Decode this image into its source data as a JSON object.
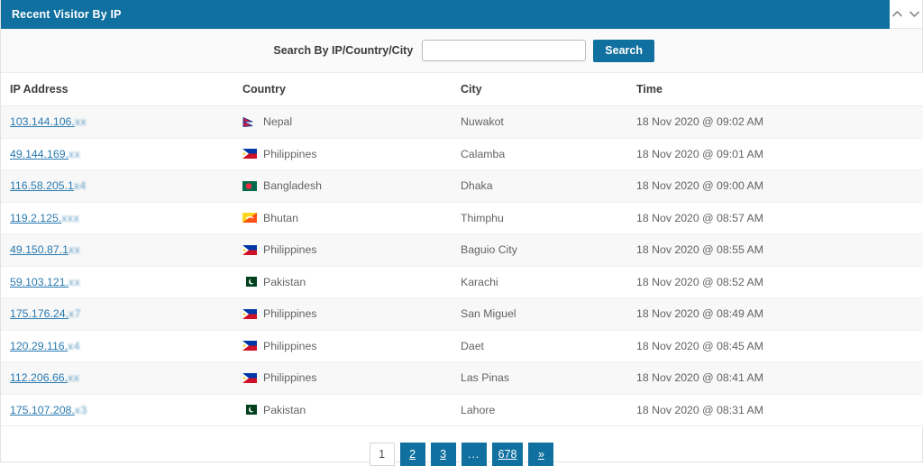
{
  "widget": {
    "title": "Recent Visitor By IP",
    "collapse_icon": "chevron-up-icon",
    "expand_icon": "chevron-down-icon"
  },
  "search": {
    "label": "Search By IP/Country/City",
    "value": "",
    "placeholder": "",
    "button_label": "Search"
  },
  "table": {
    "columns": [
      "IP Address",
      "Country",
      "City",
      "Time"
    ],
    "rows": [
      {
        "ip_visible": "103.144.106.",
        "ip_masked": "xx",
        "country": "Nepal",
        "flag": "flag-nepal",
        "city": "Nuwakot",
        "time": "18 Nov 2020 @ 09:02 AM"
      },
      {
        "ip_visible": "49.144.169.",
        "ip_masked": "xx",
        "country": "Philippines",
        "flag": "flag-philippines",
        "city": "Calamba",
        "time": "18 Nov 2020 @ 09:01 AM"
      },
      {
        "ip_visible": "116.58.205.1",
        "ip_masked": "x4",
        "country": "Bangladesh",
        "flag": "flag-bangladesh",
        "city": "Dhaka",
        "time": "18 Nov 2020 @ 09:00 AM"
      },
      {
        "ip_visible": "119.2.125.",
        "ip_masked": "xxx",
        "country": "Bhutan",
        "flag": "flag-bhutan",
        "city": "Thimphu",
        "time": "18 Nov 2020 @ 08:57 AM"
      },
      {
        "ip_visible": "49.150.87.1",
        "ip_masked": "xx",
        "country": "Philippines",
        "flag": "flag-philippines",
        "city": "Baguio City",
        "time": "18 Nov 2020 @ 08:55 AM"
      },
      {
        "ip_visible": "59.103.121.",
        "ip_masked": "xx",
        "country": "Pakistan",
        "flag": "flag-pakistan",
        "city": "Karachi",
        "time": "18 Nov 2020 @ 08:52 AM"
      },
      {
        "ip_visible": "175.176.24.",
        "ip_masked": "x7",
        "country": "Philippines",
        "flag": "flag-philippines",
        "city": "San Miguel",
        "time": "18 Nov 2020 @ 08:49 AM"
      },
      {
        "ip_visible": "120.29.116.",
        "ip_masked": "x4",
        "country": "Philippines",
        "flag": "flag-philippines",
        "city": "Daet",
        "time": "18 Nov 2020 @ 08:45 AM"
      },
      {
        "ip_visible": "112.206.66.",
        "ip_masked": "xx",
        "country": "Philippines",
        "flag": "flag-philippines",
        "city": "Las Pinas",
        "time": "18 Nov 2020 @ 08:41 AM"
      },
      {
        "ip_visible": "175.107.208.",
        "ip_masked": "x3",
        "country": "Pakistan",
        "flag": "flag-pakistan",
        "city": "Lahore",
        "time": "18 Nov 2020 @ 08:31 AM"
      }
    ]
  },
  "pagination": {
    "pages": [
      {
        "label": "1",
        "active": true,
        "kind": "page"
      },
      {
        "label": "2",
        "active": false,
        "kind": "page"
      },
      {
        "label": "3",
        "active": false,
        "kind": "page"
      },
      {
        "label": "...",
        "active": false,
        "kind": "ellipsis"
      },
      {
        "label": "678",
        "active": false,
        "kind": "page"
      },
      {
        "label": "»",
        "active": false,
        "kind": "next"
      }
    ]
  },
  "colors": {
    "header_blue": "#10709f",
    "link_blue": "#2a7ab0",
    "row_stripe": "#f8f8f8",
    "text": "#636363"
  }
}
